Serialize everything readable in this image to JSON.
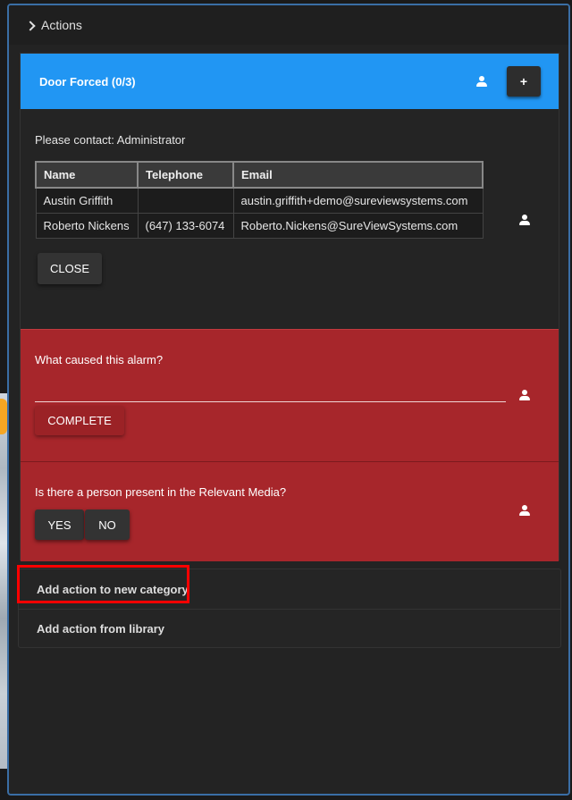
{
  "panel": {
    "header_label": "Actions"
  },
  "category": {
    "title": "Door Forced (0/3)",
    "add_label": "+",
    "accent_color": "#2196f3"
  },
  "contact_action": {
    "text": "Please contact: Administrator",
    "columns": [
      "Name",
      "Telephone",
      "Email"
    ],
    "rows": [
      {
        "name": "Austin Griffith",
        "telephone": "",
        "email": "austin.griffith+demo@sureviewsystems.com"
      },
      {
        "name": "Roberto Nickens",
        "telephone": "(647) 133-6074",
        "email": "Roberto.Nickens@SureViewSystems.com"
      }
    ],
    "close_label": "CLOSE"
  },
  "question_action": {
    "text": "What caused this alarm?",
    "input_value": "",
    "complete_label": "COMPLETE",
    "bg_color": "#a7262b"
  },
  "yesno_action": {
    "text": "Is there a person present in the Relevant Media?",
    "yes_label": "YES",
    "no_label": "NO"
  },
  "add_menu": {
    "new_category_label": "Add action to new category",
    "from_library_label": "Add action from library"
  }
}
